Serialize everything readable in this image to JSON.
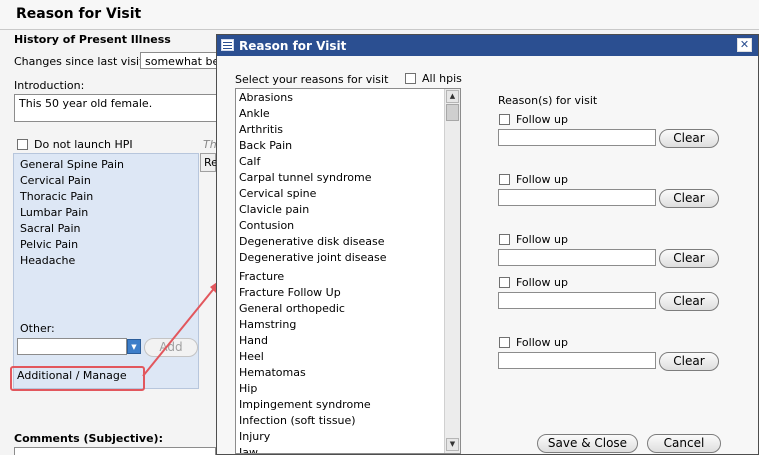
{
  "page": {
    "title": "Reason for Visit"
  },
  "hpi": {
    "section_title": "History of Present Illness",
    "changes_label": "Changes since last visit:",
    "changes_value": "somewhat better",
    "intro_label": "Introduction:",
    "intro_value": "This 50 year old female.",
    "do_not_launch_label": "Do not launch HPI",
    "partial_label": "Th",
    "tab_partial": "Re",
    "items": [
      "General Spine Pain",
      "Cervical Pain",
      "Thoracic Pain",
      "Lumbar Pain",
      "Sacral Pain",
      "Pelvic Pain",
      "Headache"
    ],
    "other_label": "Other:",
    "add_label": "Add",
    "manage_label": "Additional / Manage",
    "comments_label": "Comments (Subjective):",
    "highlight_color": "#e2575d"
  },
  "dialog": {
    "title": "Reason for Visit",
    "close_glyph": "✕",
    "select_label": "Select your reasons for visit",
    "all_hpis_label": "All hpis",
    "reasons": [
      "Abrasions",
      "Ankle",
      "Arthritis",
      "Back Pain",
      "Calf",
      "Carpal tunnel syndrome",
      "Cervical spine",
      "Clavicle pain",
      "Contusion",
      "Degenerative disk disease",
      "Degenerative joint disease",
      "Fracture",
      "Fracture Follow Up",
      "General orthopedic",
      "Hamstring",
      "Hand",
      "Heel",
      "Hematomas",
      "Hip",
      "Impingement syndrome",
      "Infection (soft tissue)",
      "Injury",
      "Jaw"
    ],
    "reasons_header": "Reason(s) for visit",
    "slots": [
      {
        "follow_up_label": "Follow up",
        "clear_label": "Clear"
      },
      {
        "follow_up_label": "Follow up",
        "clear_label": "Clear"
      },
      {
        "follow_up_label": "Follow up",
        "clear_label": "Clear"
      },
      {
        "follow_up_label": "Follow up",
        "clear_label": "Clear"
      },
      {
        "follow_up_label": "Follow up",
        "clear_label": "Clear"
      }
    ],
    "save_close_label": "Save & Close",
    "cancel_label": "Cancel",
    "titlebar_color": "#2b4f91"
  }
}
